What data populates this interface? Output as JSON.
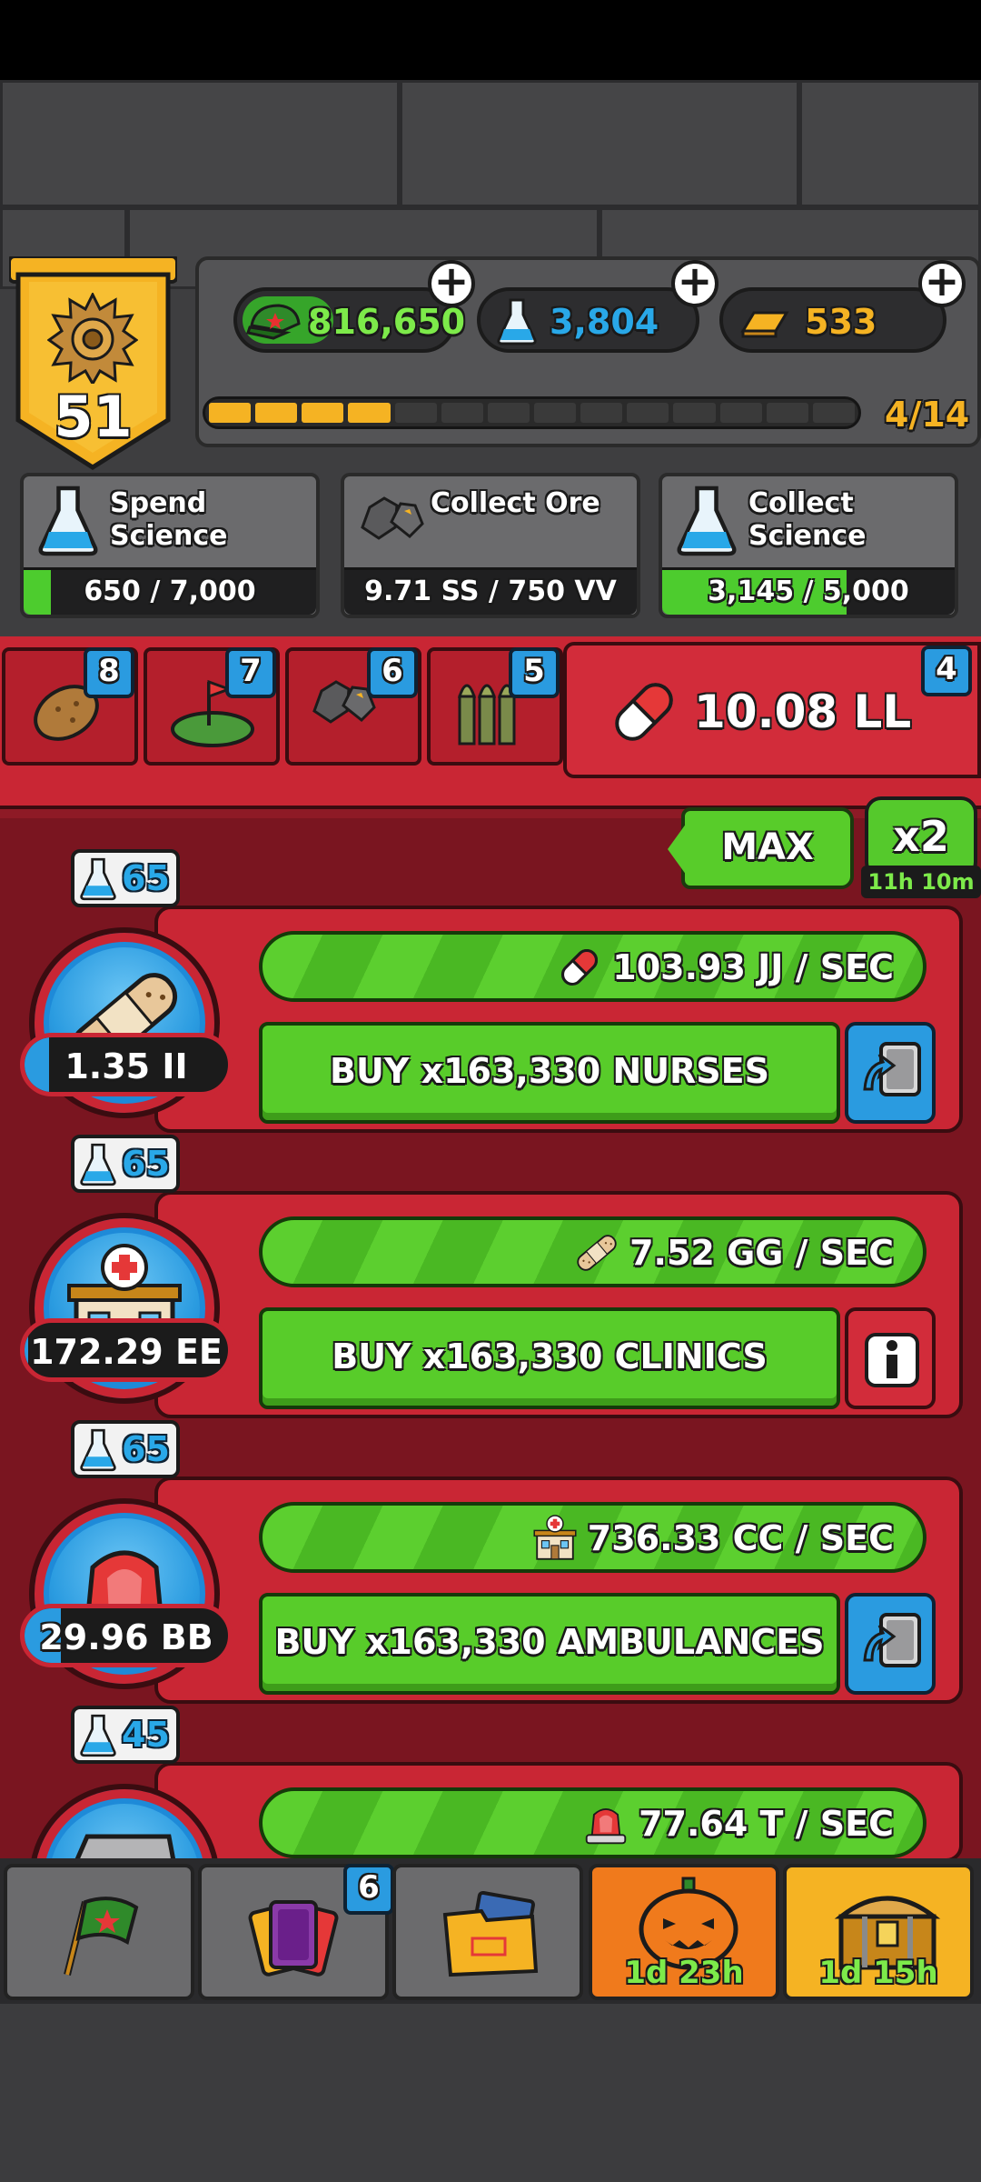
{
  "player": {
    "level": "51",
    "xp_progress": "4/14",
    "xp_filled_segments": 4,
    "xp_total_segments": 14
  },
  "currencies": {
    "cash": "816,650",
    "science": "3,804",
    "gold": "533"
  },
  "quests": [
    {
      "title_line1": "Spend",
      "title_line2": "Science",
      "progress": "650 / 7,000",
      "fraction": 0.093,
      "icon": "science-flask-icon"
    },
    {
      "title_line1": "Collect Ore",
      "title_line2": "",
      "progress": "9.71 SS / 750 VV",
      "fraction": 0.0,
      "icon": "ore-icon"
    },
    {
      "title_line1": "Collect",
      "title_line2": "Science",
      "progress": "3,145 / 5,000",
      "fraction": 0.629,
      "icon": "science-flask-icon"
    }
  ],
  "tabs": [
    {
      "badge": "8",
      "icon": "potato-icon"
    },
    {
      "badge": "7",
      "icon": "land-flag-icon"
    },
    {
      "badge": "6",
      "icon": "ore-icon"
    },
    {
      "badge": "5",
      "icon": "bullets-icon"
    }
  ],
  "selected_tab": {
    "badge": "4",
    "resource": "10.08 LL",
    "icon": "pill-icon"
  },
  "buy_mode": {
    "max_label": "MAX",
    "boost_label": "x2",
    "boost_timer": "11h 10m"
  },
  "items": [
    {
      "science_cost": "65",
      "owned": "1.35 II",
      "owned_fraction": 0.12,
      "rate": "103.93 JJ / SEC",
      "buy_label": "BUY x163,330 NURSES",
      "side": "upgrade",
      "icon": "bandage-icon",
      "rate_icon": "pill-icon"
    },
    {
      "science_cost": "65",
      "owned": "172.29 EE",
      "owned_fraction": 0.02,
      "rate": "7.52 GG / SEC",
      "buy_label": "BUY x163,330 CLINICS",
      "side": "info",
      "icon": "clinic-icon",
      "rate_icon": "bandage-icon"
    },
    {
      "science_cost": "65",
      "owned": "29.96 BB",
      "owned_fraction": 0.18,
      "rate": "736.33 CC / SEC",
      "buy_label": "BUY x163,330 AMBULANCES",
      "side": "upgrade",
      "icon": "siren-icon",
      "rate_icon": "clinic-icon"
    },
    {
      "science_cost": "45",
      "rate": "77.64 T / SEC",
      "icon": "ice-chest-icon",
      "rate_icon": "siren-icon"
    }
  ],
  "nav": [
    {
      "icon": "flag-icon",
      "badge": "",
      "timer": ""
    },
    {
      "icon": "cards-icon",
      "badge": "6",
      "timer": ""
    },
    {
      "icon": "folder-icon",
      "badge": "",
      "timer": ""
    },
    {
      "icon": "pumpkin-icon",
      "badge": "",
      "timer": "1d 23h"
    },
    {
      "icon": "treasure-chest-icon",
      "badge": "",
      "timer": "1d 15h"
    }
  ],
  "colors": {
    "green": "#58cc2a",
    "red": "#c92634",
    "blue": "#2a9be0",
    "gold": "#f5b323"
  }
}
